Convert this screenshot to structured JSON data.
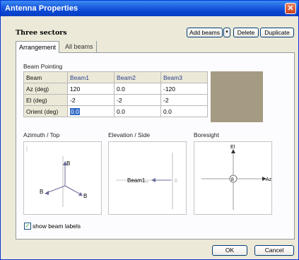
{
  "window": {
    "title": "Antenna Properties",
    "close_glyph": "✕"
  },
  "header": {
    "title": "Three sectors"
  },
  "toolbar": {
    "add_beams": "Add beams",
    "dropdown_glyph": "▾",
    "delete": "Delete",
    "duplicate": "Duplicate"
  },
  "tabs": [
    {
      "label": "Arrangement"
    },
    {
      "label": "All beams"
    }
  ],
  "beam_pointing": {
    "label": "Beam Pointing",
    "columns": [
      "Beam",
      "Beam1",
      "Beam2",
      "Beam3"
    ],
    "rows": [
      {
        "label": "Az (deg)",
        "values": [
          "120",
          "0.0",
          "-120"
        ]
      },
      {
        "label": "El (deg)",
        "values": [
          "-2",
          "-2",
          "-2"
        ]
      },
      {
        "label": "Orient (deg)",
        "values": [
          "0.0",
          "0.0",
          "0.0"
        ]
      }
    ]
  },
  "views": {
    "azimuth": {
      "label": "Azimuth / Top",
      "beam_labels": [
        "B",
        "B",
        "B"
      ]
    },
    "elevation": {
      "label": "Elevation / Side",
      "beam_text": "Beam1..",
      "tick": "0"
    },
    "boresight": {
      "label": "Boresight",
      "el_label": "El",
      "az_label": "Az",
      "center_label": "B"
    }
  },
  "show_beam_labels": {
    "label": "show beam labels",
    "checked": true,
    "check_glyph": "✓"
  },
  "footer": {
    "ok": "OK",
    "cancel": "Cancel"
  }
}
